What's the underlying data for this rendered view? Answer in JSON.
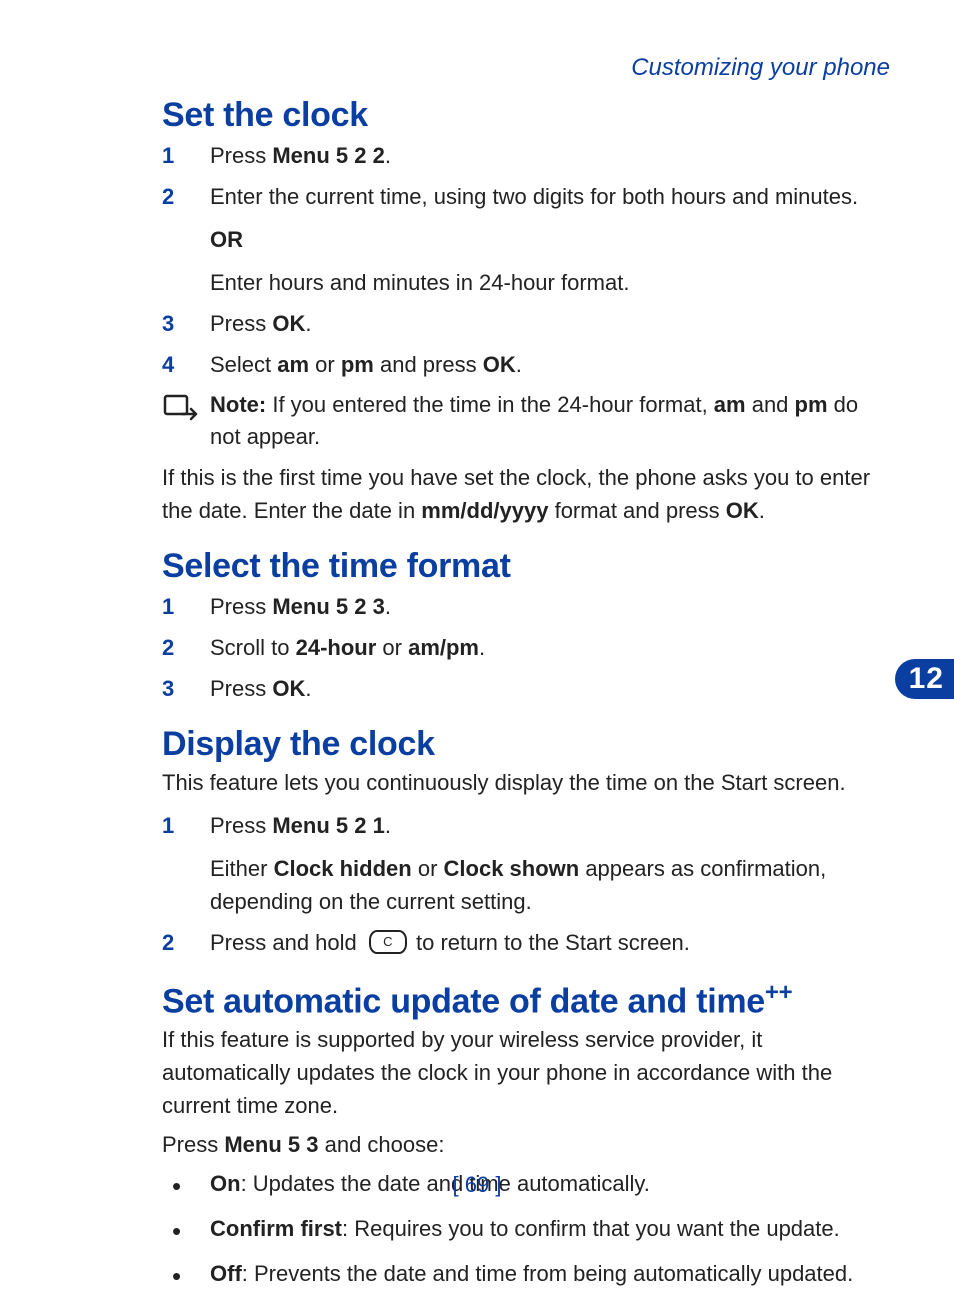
{
  "header": {
    "chapter_title": "Customizing your phone"
  },
  "section1": {
    "title": "Set the clock",
    "step1_pre": "Press ",
    "step1_bold": "Menu 5 2 2",
    "step1_post": ".",
    "step2_main": "Enter the current time, using two digits for both hours and minutes.",
    "step2_or": "OR",
    "step2_alt": "Enter hours and minutes in 24-hour format.",
    "step3_pre": "Press ",
    "step3_bold": "OK",
    "step3_post": ".",
    "step4_pre": "Select ",
    "step4_b1": "am",
    "step4_mid1": " or ",
    "step4_b2": "pm",
    "step4_mid2": " and press ",
    "step4_b3": "OK",
    "step4_post": ".",
    "note_label": "Note:",
    "note_t1": " If you entered the time in the 24-hour format, ",
    "note_b1": "am",
    "note_t2": " and ",
    "note_b2": "pm",
    "note_t3": " do not appear.",
    "para_t1": "If this is the first time you have set the clock, the phone asks you to enter the date. Enter the date in ",
    "para_b1": "mm/dd/yyyy",
    "para_t2": " format and press ",
    "para_b2": "OK",
    "para_t3": "."
  },
  "section2": {
    "title": "Select the time format",
    "step1_pre": "Press ",
    "step1_bold": "Menu 5 2 3",
    "step1_post": ".",
    "step2_pre": "Scroll to ",
    "step2_b1": "24-hour",
    "step2_mid": " or ",
    "step2_b2": "am/pm",
    "step2_post": ".",
    "step3_pre": "Press ",
    "step3_bold": "OK",
    "step3_post": "."
  },
  "section3": {
    "title": "Display the clock",
    "lead": "This feature lets you continuously display the time on the Start screen.",
    "step1_pre": "Press ",
    "step1_bold": "Menu 5 2 1",
    "step1_post": ".",
    "step1_sub_t1": "Either ",
    "step1_sub_b1": "Clock hidden",
    "step1_sub_t2": " or ",
    "step1_sub_b2": "Clock shown",
    "step1_sub_t3": " appears as confirmation, depending on the current setting.",
    "step2_pre": "Press and hold ",
    "step2_keylabel": "C",
    "step2_post": " to return to the Start screen."
  },
  "section4": {
    "title": "Set automatic update of date and time",
    "title_sup": "++",
    "lead": "If this feature is supported by your wireless service provider, it automatically updates the clock in your phone in accordance with the current time zone.",
    "press_t1": "Press ",
    "press_b1": "Menu 5 3",
    "press_t2": " and choose:",
    "bullet1_b": "On",
    "bullet1_t": ": Updates the date and time automatically.",
    "bullet2_b": "Confirm first",
    "bullet2_t": ": Requires you to confirm that you want the update.",
    "bullet3_b": "Off",
    "bullet3_t": ": Prevents the date and time from being automatically updated."
  },
  "page_tab": "12",
  "footer": "[ 69 ]"
}
